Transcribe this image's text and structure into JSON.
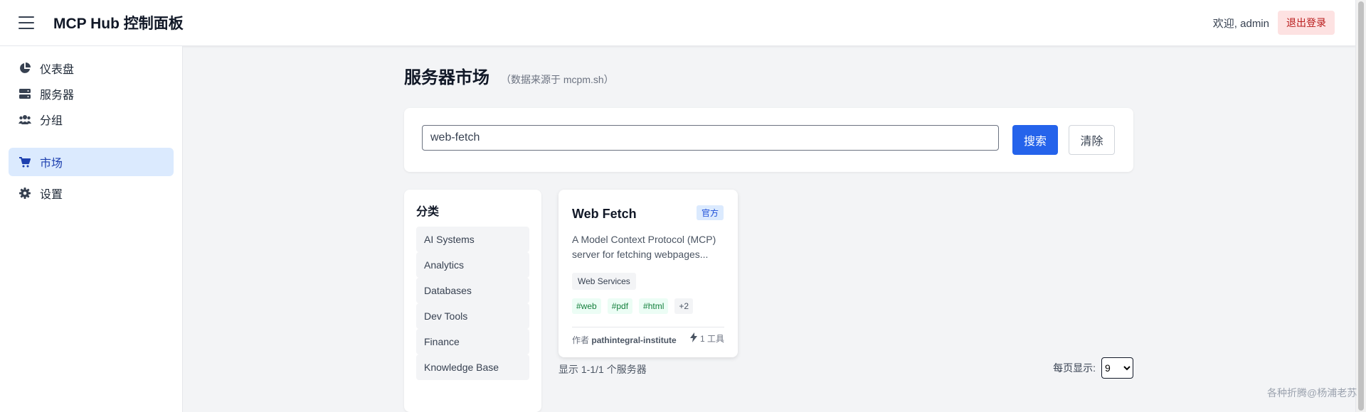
{
  "header": {
    "title": "MCP Hub 控制面板",
    "welcome": "欢迎, admin",
    "logout_label": "退出登录"
  },
  "sidebar": {
    "items": [
      {
        "label": "仪表盘",
        "icon": "dashboard-pie-icon",
        "active": false
      },
      {
        "label": "服务器",
        "icon": "server-icon",
        "active": false
      },
      {
        "label": "分组",
        "icon": "users-group-icon",
        "active": false
      },
      {
        "label": "市场",
        "icon": "shopping-cart-icon",
        "active": true
      },
      {
        "label": "设置",
        "icon": "gear-icon",
        "active": false
      }
    ]
  },
  "main": {
    "title": "服务器市场",
    "subtitle": "（数据来源于 mcpm.sh）",
    "search": {
      "value": "web-fetch",
      "search_label": "搜索",
      "clear_label": "清除"
    },
    "categories": {
      "title": "分类",
      "items": [
        "AI Systems",
        "Analytics",
        "Databases",
        "Dev Tools",
        "Finance",
        "Knowledge Base"
      ]
    },
    "servers": [
      {
        "name": "Web Fetch",
        "badge": "官方",
        "description": "A Model Context Protocol (MCP) server for fetching webpages...",
        "category": "Web Services",
        "tags": [
          "#web",
          "#pdf",
          "#html"
        ],
        "more_tags": "+2",
        "author_prefix": "作者",
        "author": "pathintegral-institute",
        "tools": "1 工具"
      }
    ],
    "summary": "显示 1-1/1 个服务器",
    "per_page_label": "每页显示:",
    "per_page_value": "9",
    "per_page_options": [
      "9"
    ]
  },
  "watermark": "各种折腾@杨浦老苏",
  "colors": {
    "primary": "#2563eb",
    "active_nav_bg": "#dbeafe",
    "logout_bg": "#fde2e2",
    "logout_text": "#b91c1c",
    "tag_green": "#15803d"
  }
}
